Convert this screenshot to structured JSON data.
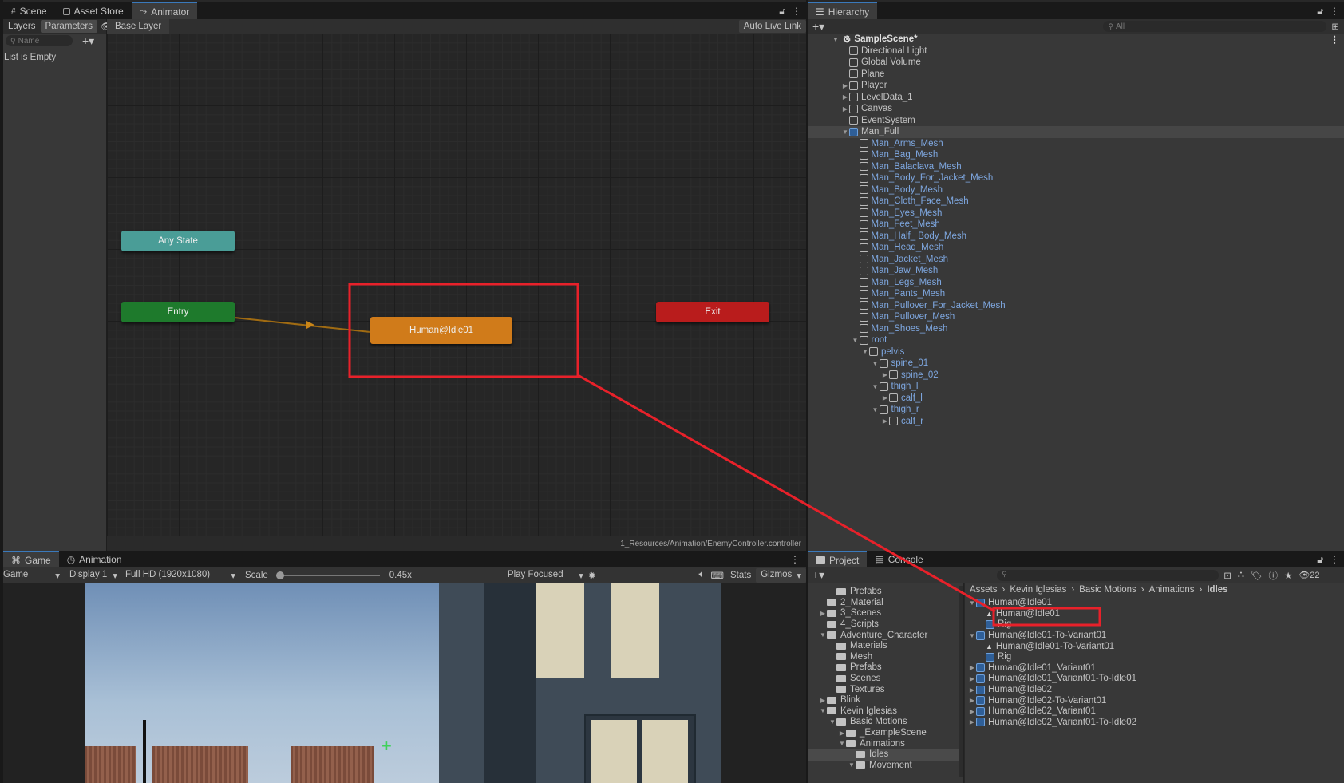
{
  "animator_window": {
    "tabs": [
      {
        "label": "Scene",
        "icon": "grid-icon"
      },
      {
        "label": "Asset Store",
        "icon": "bag-icon"
      },
      {
        "label": "Animator",
        "icon": "animator-icon"
      }
    ],
    "left_tabs": [
      "Layers",
      "Parameters"
    ],
    "search_placeholder": "Name",
    "breadcrumb": "Base Layer",
    "auto_live_link": "Auto Live Link",
    "empty_list": "List is Empty",
    "states": {
      "any_state": "Any State",
      "entry": "Entry",
      "default_state": "Human@Idle01",
      "exit": "Exit"
    },
    "controller_path": "1_Resources/Animation/EnemyController.controller",
    "colors": {
      "any": "#4a9d97",
      "entry": "#1e7a2c",
      "default": "#d07b1a",
      "exit": "#b91c1c",
      "highlight": "#e8212a"
    }
  },
  "hierarchy": {
    "title": "Hierarchy",
    "search_placeholder": "All",
    "scene_name": "SampleScene*",
    "items": [
      {
        "label": "Directional Light",
        "depth": 0,
        "arrow": "",
        "prefab": false
      },
      {
        "label": "Global Volume",
        "depth": 0,
        "arrow": "",
        "prefab": false
      },
      {
        "label": "Plane",
        "depth": 0,
        "arrow": "",
        "prefab": false
      },
      {
        "label": "Player",
        "depth": 0,
        "arrow": "▶",
        "prefab": false
      },
      {
        "label": "LevelData_1",
        "depth": 0,
        "arrow": "▶",
        "prefab": false
      },
      {
        "label": "Canvas",
        "depth": 0,
        "arrow": "▶",
        "prefab": false
      },
      {
        "label": "EventSystem",
        "depth": 0,
        "arrow": "",
        "prefab": false
      },
      {
        "label": "Man_Full",
        "depth": 0,
        "arrow": "▼",
        "prefab": true,
        "selected": true
      },
      {
        "label": "Man_Arms_Mesh",
        "depth": 1,
        "arrow": "",
        "prefab": false,
        "blue": true
      },
      {
        "label": "Man_Bag_Mesh",
        "depth": 1,
        "arrow": "",
        "prefab": false,
        "blue": true
      },
      {
        "label": "Man_Balaclava_Mesh",
        "depth": 1,
        "arrow": "",
        "prefab": false,
        "blue": true
      },
      {
        "label": "Man_Body_For_Jacket_Mesh",
        "depth": 1,
        "arrow": "",
        "prefab": false,
        "blue": true
      },
      {
        "label": "Man_Body_Mesh",
        "depth": 1,
        "arrow": "",
        "prefab": false,
        "blue": true
      },
      {
        "label": "Man_Cloth_Face_Mesh",
        "depth": 1,
        "arrow": "",
        "prefab": false,
        "blue": true
      },
      {
        "label": "Man_Eyes_Mesh",
        "depth": 1,
        "arrow": "",
        "prefab": false,
        "blue": true
      },
      {
        "label": "Man_Feet_Mesh",
        "depth": 1,
        "arrow": "",
        "prefab": false,
        "blue": true
      },
      {
        "label": "Man_Half_ Body_Mesh",
        "depth": 1,
        "arrow": "",
        "prefab": false,
        "blue": true
      },
      {
        "label": "Man_Head_Mesh",
        "depth": 1,
        "arrow": "",
        "prefab": false,
        "blue": true
      },
      {
        "label": "Man_Jacket_Mesh",
        "depth": 1,
        "arrow": "",
        "prefab": false,
        "blue": true
      },
      {
        "label": "Man_Jaw_Mesh",
        "depth": 1,
        "arrow": "",
        "prefab": false,
        "blue": true
      },
      {
        "label": "Man_Legs_Mesh",
        "depth": 1,
        "arrow": "",
        "prefab": false,
        "blue": true
      },
      {
        "label": "Man_Pants_Mesh",
        "depth": 1,
        "arrow": "",
        "prefab": false,
        "blue": true
      },
      {
        "label": "Man_Pullover_For_Jacket_Mesh",
        "depth": 1,
        "arrow": "",
        "prefab": false,
        "blue": true
      },
      {
        "label": "Man_Pullover_Mesh",
        "depth": 1,
        "arrow": "",
        "prefab": false,
        "blue": true
      },
      {
        "label": "Man_Shoes_Mesh",
        "depth": 1,
        "arrow": "",
        "prefab": false,
        "blue": true
      },
      {
        "label": "root",
        "depth": 1,
        "arrow": "▼",
        "prefab": false,
        "blue": true
      },
      {
        "label": "pelvis",
        "depth": 2,
        "arrow": "▼",
        "prefab": false,
        "blue": true
      },
      {
        "label": "spine_01",
        "depth": 3,
        "arrow": "▼",
        "prefab": false,
        "blue": true
      },
      {
        "label": "spine_02",
        "depth": 4,
        "arrow": "▶",
        "prefab": false,
        "blue": true
      },
      {
        "label": "thigh_l",
        "depth": 3,
        "arrow": "▼",
        "prefab": false,
        "blue": true
      },
      {
        "label": "calf_l",
        "depth": 4,
        "arrow": "▶",
        "prefab": false,
        "blue": true
      },
      {
        "label": "thigh_r",
        "depth": 3,
        "arrow": "▼",
        "prefab": false,
        "blue": true
      },
      {
        "label": "calf_r",
        "depth": 4,
        "arrow": "▶",
        "prefab": false,
        "blue": true
      }
    ]
  },
  "game_window": {
    "tabs": [
      {
        "label": "Game",
        "icon": "gamepad-icon"
      },
      {
        "label": "Animation",
        "icon": "animation-icon"
      }
    ],
    "game_dropdown": "Game",
    "display": "Display 1",
    "resolution": "Full HD (1920x1080)",
    "scale_label": "Scale",
    "scale_value": "0.45x",
    "play_focused": "Play Focused",
    "stats": "Stats",
    "gizmos": "Gizmos"
  },
  "project_window": {
    "tabs": [
      {
        "label": "Project",
        "icon": "folder-icon"
      },
      {
        "label": "Console",
        "icon": "console-icon"
      }
    ],
    "count_badge": "22",
    "breadcrumb": [
      "Assets",
      "Kevin Iglesias",
      "Basic Motions",
      "Animations",
      "Idles"
    ],
    "folders": [
      {
        "label": "Prefabs",
        "depth": 1,
        "arrow": ""
      },
      {
        "label": "2_Material",
        "depth": 0,
        "arrow": ""
      },
      {
        "label": "3_Scenes",
        "depth": 0,
        "arrow": "▶"
      },
      {
        "label": "4_Scripts",
        "depth": 0,
        "arrow": ""
      },
      {
        "label": "Adventure_Character",
        "depth": 0,
        "arrow": "▼"
      },
      {
        "label": "Materials",
        "depth": 1,
        "arrow": ""
      },
      {
        "label": "Mesh",
        "depth": 1,
        "arrow": ""
      },
      {
        "label": "Prefabs",
        "depth": 1,
        "arrow": ""
      },
      {
        "label": "Scenes",
        "depth": 1,
        "arrow": ""
      },
      {
        "label": "Textures",
        "depth": 1,
        "arrow": ""
      },
      {
        "label": "Blink",
        "depth": 0,
        "arrow": "▶"
      },
      {
        "label": "Kevin Iglesias",
        "depth": 0,
        "arrow": "▼"
      },
      {
        "label": "Basic Motions",
        "depth": 1,
        "arrow": "▼"
      },
      {
        "label": "_ExampleScene",
        "depth": 2,
        "arrow": "▶"
      },
      {
        "label": "Animations",
        "depth": 2,
        "arrow": "▼"
      },
      {
        "label": "Idles",
        "depth": 3,
        "arrow": "",
        "selected": true
      },
      {
        "label": "Movement",
        "depth": 3,
        "arrow": "▼"
      }
    ],
    "assets": [
      {
        "label": "Human@Idle01",
        "depth": 0,
        "arrow": "▼",
        "kind": "model"
      },
      {
        "label": "Human@Idle01",
        "depth": 1,
        "arrow": "",
        "kind": "clip",
        "highlight": true
      },
      {
        "label": "Rig",
        "depth": 1,
        "arrow": "",
        "kind": "avatar"
      },
      {
        "label": "Human@Idle01-To-Variant01",
        "depth": 0,
        "arrow": "▼",
        "kind": "model"
      },
      {
        "label": "Human@Idle01-To-Variant01",
        "depth": 1,
        "arrow": "",
        "kind": "clip"
      },
      {
        "label": "Rig",
        "depth": 1,
        "arrow": "",
        "kind": "avatar"
      },
      {
        "label": "Human@Idle01_Variant01",
        "depth": 0,
        "arrow": "▶",
        "kind": "model"
      },
      {
        "label": "Human@Idle01_Variant01-To-Idle01",
        "depth": 0,
        "arrow": "▶",
        "kind": "model"
      },
      {
        "label": "Human@Idle02",
        "depth": 0,
        "arrow": "▶",
        "kind": "model"
      },
      {
        "label": "Human@Idle02-To-Variant01",
        "depth": 0,
        "arrow": "▶",
        "kind": "model"
      },
      {
        "label": "Human@Idle02_Variant01",
        "depth": 0,
        "arrow": "▶",
        "kind": "model"
      },
      {
        "label": "Human@Idle02_Variant01-To-Idle02",
        "depth": 0,
        "arrow": "▶",
        "kind": "model"
      }
    ]
  }
}
